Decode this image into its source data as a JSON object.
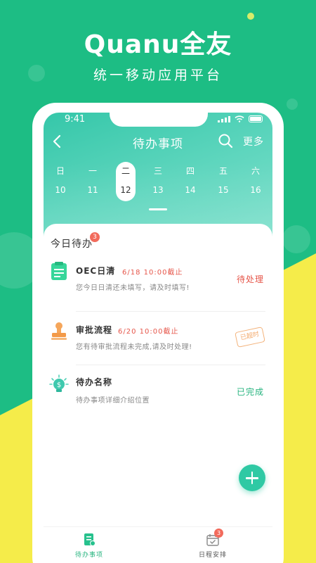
{
  "brand": {
    "name": "Quanu全友",
    "tagline": "统一移动应用平台"
  },
  "status_bar": {
    "time": "9:41"
  },
  "nav": {
    "title": "待办事项",
    "more_label": "更多"
  },
  "calendar": {
    "days": [
      {
        "weekday": "日",
        "date": "10",
        "selected": false
      },
      {
        "weekday": "一",
        "date": "11",
        "selected": false
      },
      {
        "weekday": "二",
        "date": "12",
        "selected": true
      },
      {
        "weekday": "三",
        "date": "13",
        "selected": false
      },
      {
        "weekday": "四",
        "date": "14",
        "selected": false
      },
      {
        "weekday": "五",
        "date": "15",
        "selected": false
      },
      {
        "weekday": "六",
        "date": "16",
        "selected": false
      }
    ]
  },
  "today": {
    "title": "今日待办",
    "badge": "3",
    "tasks": [
      {
        "title": "OEC日清",
        "due": "6/18 10:00截止",
        "desc": "您今日日清还未填写，请及时填写!",
        "status": "待处理",
        "status_color": "#e6564a",
        "icon": "clipboard-icon"
      },
      {
        "title": "审批流程",
        "due": "6/20 10:00截止",
        "desc": "您有待审批流程未完成,请及时处理!",
        "status": "已超时",
        "status_color": "#f3a96b",
        "icon": "stamp-icon"
      },
      {
        "title": "待办名称",
        "due": "",
        "desc": "待办事项详细介绍位置",
        "status": "已完成",
        "status_color": "#27b47f",
        "icon": "lightbulb-icon"
      }
    ]
  },
  "tabbar": {
    "tabs": [
      {
        "label": "待办事项",
        "active": true,
        "badge": ""
      },
      {
        "label": "日程安排",
        "active": false,
        "badge": "3"
      }
    ]
  },
  "colors": {
    "primary": "#1dbd84",
    "accent": "#2fc9a4",
    "yellow": "#f5ec4a",
    "alert": "#e6564a"
  }
}
